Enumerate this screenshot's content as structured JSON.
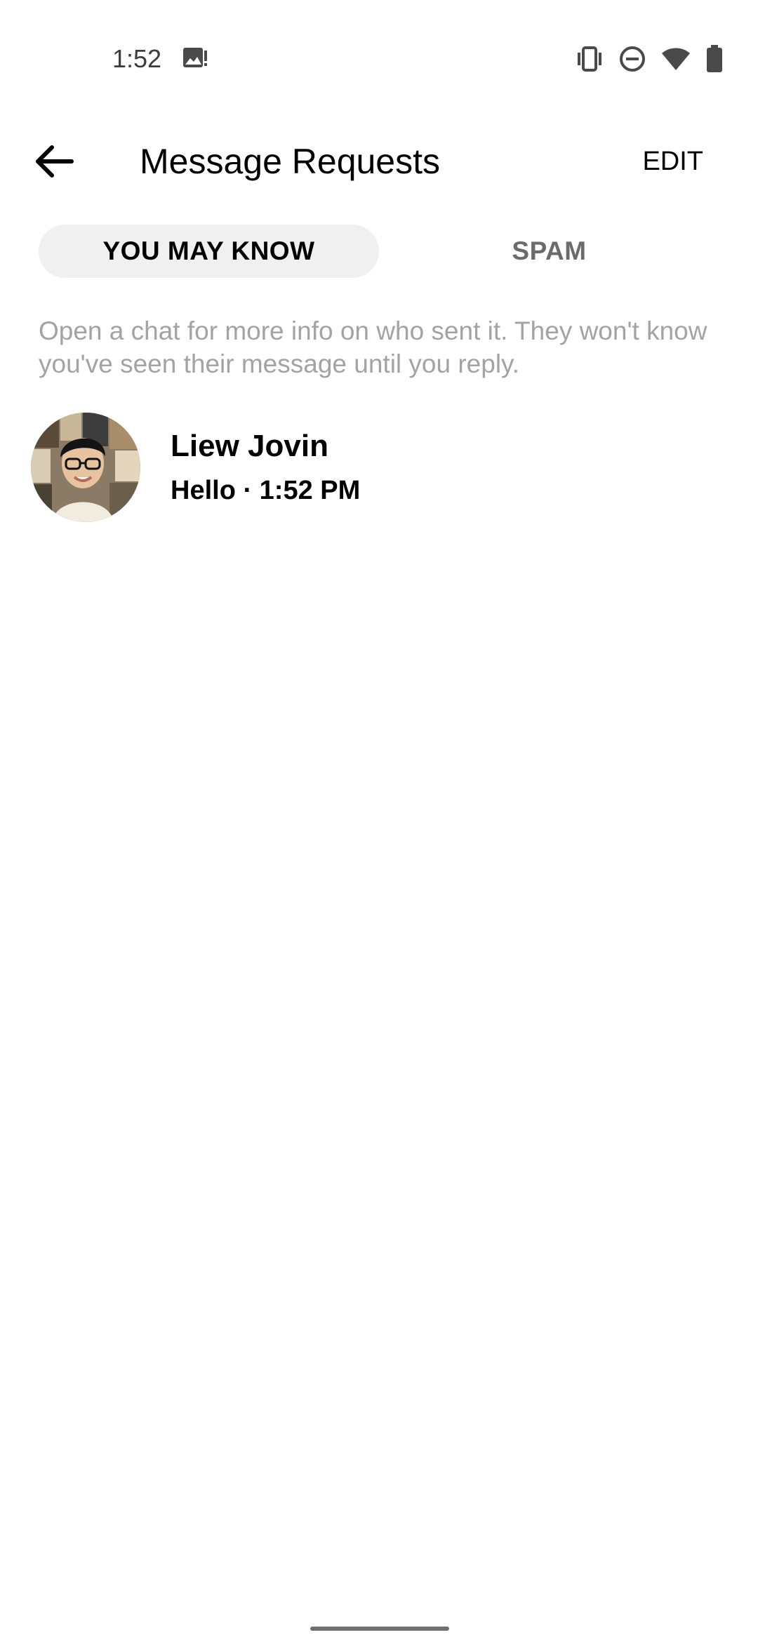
{
  "status_bar": {
    "time": "1:52",
    "icons": [
      "photo-notification-icon",
      "vibrate-icon",
      "do-not-disturb-icon",
      "wifi-icon",
      "battery-icon"
    ]
  },
  "header": {
    "title": "Message Requests",
    "edit_label": "EDIT",
    "back_icon": "arrow-left-icon"
  },
  "tabs": [
    {
      "label": "YOU MAY KNOW",
      "active": true
    },
    {
      "label": "SPAM",
      "active": false
    }
  ],
  "info_text": "Open a chat for more info on who sent it. They won't know you've seen their message until you reply.",
  "conversations": [
    {
      "name": "Liew Jovin",
      "preview": "Hello · 1:52 PM"
    }
  ],
  "colors": {
    "background": "#ffffff",
    "active_tab_bg": "#f0f0f0",
    "inactive_tab_text": "#6b6b6b",
    "info_text": "#a3a3a3"
  }
}
